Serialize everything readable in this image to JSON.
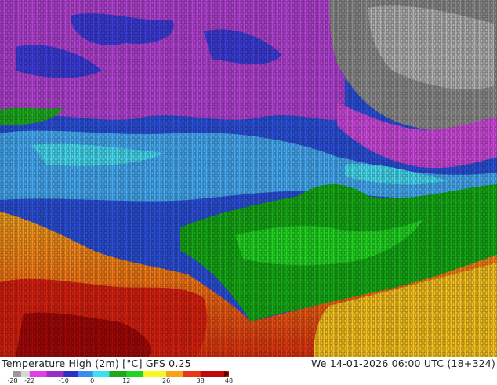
{
  "map": {
    "title": "Temperature High (2m) [°C] GFS 0.25",
    "valid_time": "We 14-01-2026 06:00 UTC (18+324)",
    "legend": {
      "ticks": [
        "-28",
        "-22",
        "-10",
        "0",
        "12",
        "26",
        "38",
        "48"
      ],
      "color_stops": [
        {
          "value": -28,
          "color": "#9a9a9a"
        },
        {
          "value": -25,
          "color": "#d7d7d7"
        },
        {
          "value": -22,
          "color": "#e03ee8"
        },
        {
          "value": -16,
          "color": "#9a2ec8"
        },
        {
          "value": -10,
          "color": "#2f2fc8"
        },
        {
          "value": -5,
          "color": "#3a8cf0"
        },
        {
          "value": 0,
          "color": "#38e0f0"
        },
        {
          "value": 6,
          "color": "#1ea81e"
        },
        {
          "value": 12,
          "color": "#22d422"
        },
        {
          "value": 18,
          "color": "#f8f820"
        },
        {
          "value": 26,
          "color": "#f8a018"
        },
        {
          "value": 32,
          "color": "#e83818"
        },
        {
          "value": 38,
          "color": "#c00808"
        },
        {
          "value": 48,
          "color": "#4a0000"
        }
      ]
    }
  }
}
